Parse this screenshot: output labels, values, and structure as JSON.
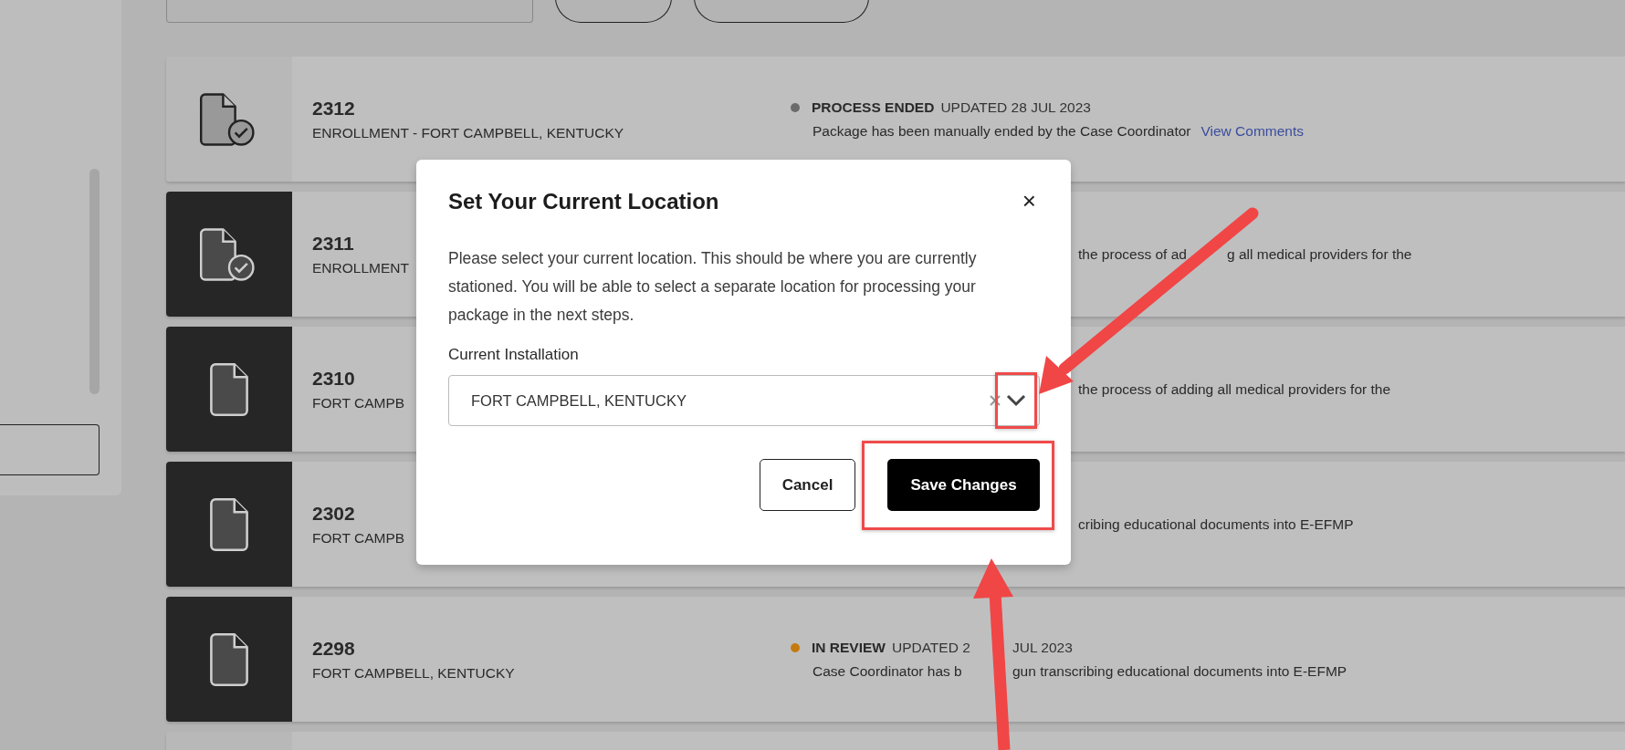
{
  "packages": [
    {
      "kind": "full",
      "number": "2312",
      "subtitle": "ENROLLMENT - FORT CAMPBELL, KENTUCKY",
      "completed": true,
      "highlighted": true,
      "status": "PROCESS ENDED",
      "color": "#6b6b6b",
      "updated": [
        "UPDATED 28 JUL 2023"
      ],
      "description": [
        "Package has been manually ended by the Case Coordinator"
      ],
      "link": "View Comments"
    },
    {
      "kind": "covered",
      "number": "2311",
      "subtitle": "ENROLLMENT",
      "completed": true,
      "highlighted": false,
      "description": [
        "the process of ad",
        "g all medical providers for the"
      ]
    },
    {
      "kind": "covered",
      "number": "2310",
      "subtitle": "FORT CAMPB",
      "completed": false,
      "highlighted": false,
      "description": [
        "the process of adding all medical providers for the"
      ]
    },
    {
      "kind": "covered",
      "number": "2302",
      "subtitle": "FORT CAMPB",
      "completed": false,
      "highlighted": false,
      "description": [
        "cribing educational documents into E-EFMP"
      ]
    },
    {
      "kind": "full",
      "number": "2298",
      "subtitle": "FORT CAMPBELL, KENTUCKY",
      "completed": false,
      "highlighted": false,
      "status": "IN REVIEW",
      "color": "#c47a10",
      "updated": [
        "UPDATED 2",
        "JUL 2023"
      ],
      "description": [
        "Case Coordinator has b",
        "gun transcribing educational documents into E-EFMP"
      ]
    },
    {
      "kind": "cut"
    }
  ],
  "modal": {
    "title": "Set Your Current Location",
    "close": "×",
    "body": "Please select your current location. This should be where you are currently stationed. You will be able to select a separate location for processing your package in the next steps.",
    "field_label": "Current Installation",
    "value": "FORT CAMPBELL, KENTUCKY",
    "dropdown_highlighted": true,
    "buttons": [
      {
        "label": "Cancel",
        "kind": "secondary",
        "highlighted": false
      },
      {
        "label": "Save Changes",
        "kind": "primary",
        "highlighted": true
      }
    ]
  }
}
